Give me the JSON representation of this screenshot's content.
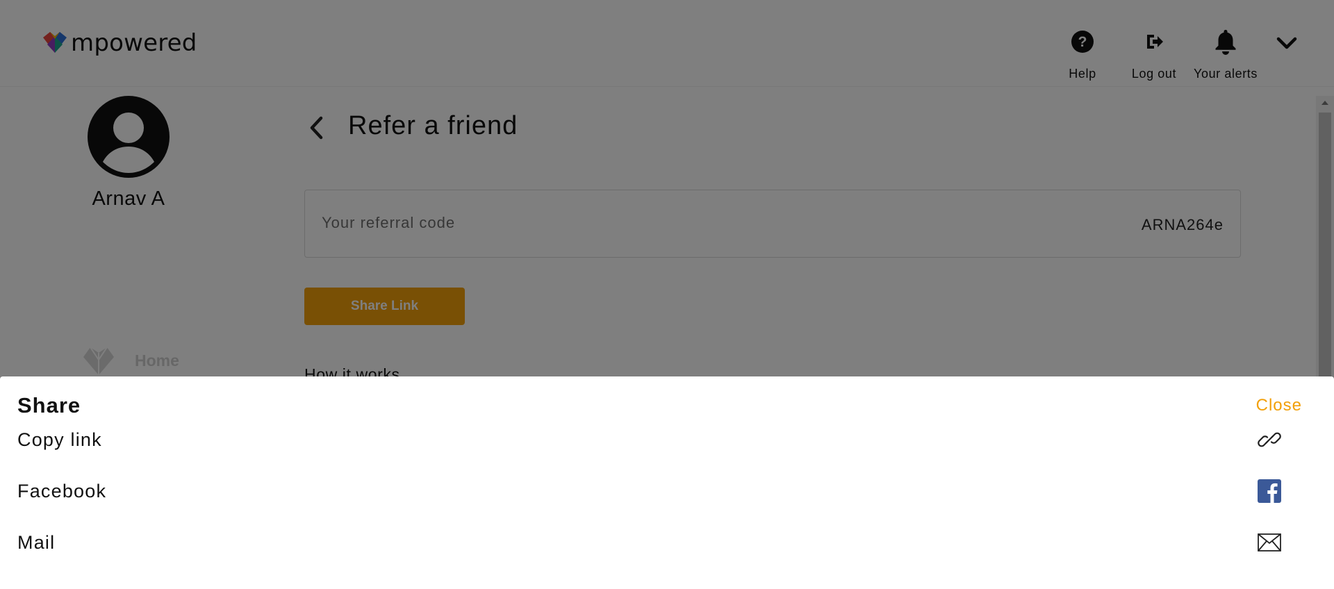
{
  "header": {
    "logo_text": "mpowered",
    "help_label": "Help",
    "logout_label": "Log out",
    "alerts_label": "Your alerts"
  },
  "sidebar": {
    "user_name": "Arnav A",
    "items": [
      {
        "label": "Home",
        "icon": "home-heart-icon"
      }
    ]
  },
  "main": {
    "title": "Refer a friend",
    "referral_label": "Your referral code",
    "referral_code": "ARNA264e",
    "share_button": "Share Link",
    "how_it_works": "How it works"
  },
  "share_sheet": {
    "title": "Share",
    "close_label": "Close",
    "options": [
      {
        "label": "Copy link",
        "icon": "link-icon"
      },
      {
        "label": "Facebook",
        "icon": "facebook-icon"
      },
      {
        "label": "Mail",
        "icon": "mail-icon"
      }
    ]
  },
  "colors": {
    "accent": "#f2a00a",
    "facebook": "#3b5998",
    "overlay": "rgba(0,0,0,0.5)"
  }
}
